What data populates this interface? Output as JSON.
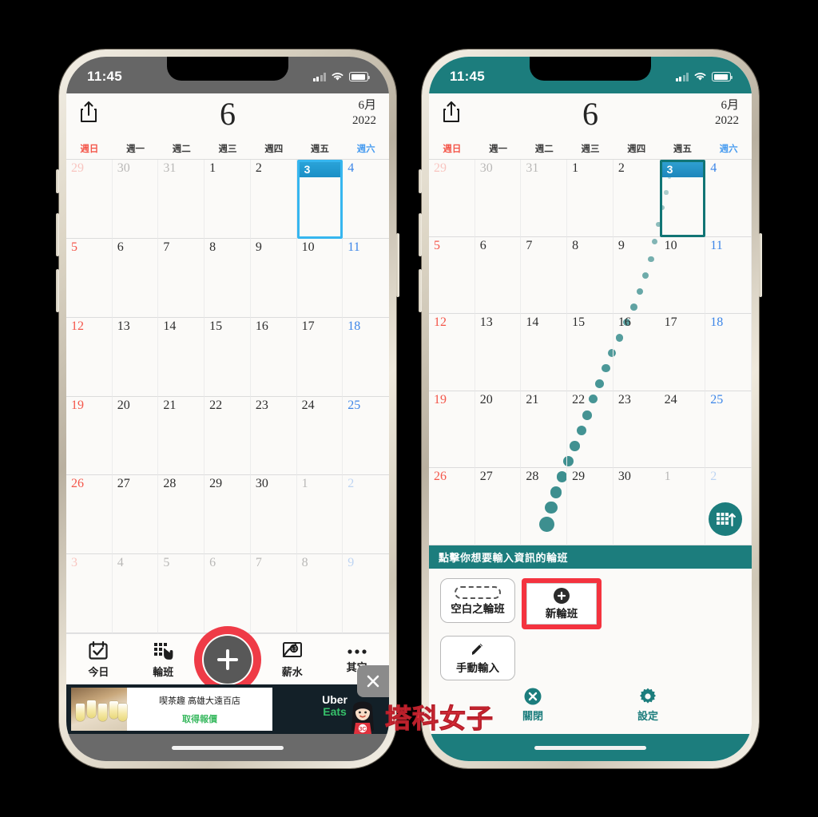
{
  "status_bar": {
    "time": "11:45",
    "signal_icon": "cellular-bars-icon",
    "wifi_icon": "wifi-icon",
    "battery_icon": "battery-icon"
  },
  "colors": {
    "teal": "#1c7d7d",
    "teal_dot": "#3d8f8f",
    "red_highlight": "#f4333f",
    "ring_red": "#ef3b47",
    "selected_blue": "#36b6ef",
    "sunday_red": "#f4564a",
    "saturday_blue": "#4a9df0",
    "status_gray": "#666666"
  },
  "header": {
    "share_icon": "share-icon",
    "month_big": "6",
    "month_label": "6月",
    "year_label": "2022"
  },
  "weekdays": [
    {
      "label": "週日",
      "kind": "sun"
    },
    {
      "label": "週一",
      "kind": "normal"
    },
    {
      "label": "週二",
      "kind": "normal"
    },
    {
      "label": "週三",
      "kind": "normal"
    },
    {
      "label": "週四",
      "kind": "normal"
    },
    {
      "label": "週五",
      "kind": "normal"
    },
    {
      "label": "週六",
      "kind": "sat"
    }
  ],
  "calendar": {
    "weeks": [
      [
        {
          "d": "29",
          "out": true,
          "kind": "sun"
        },
        {
          "d": "30",
          "out": true
        },
        {
          "d": "31",
          "out": true
        },
        {
          "d": "1"
        },
        {
          "d": "2"
        },
        {
          "d": "3",
          "selected": true
        },
        {
          "d": "4",
          "kind": "sat"
        }
      ],
      [
        {
          "d": "5",
          "kind": "sun"
        },
        {
          "d": "6"
        },
        {
          "d": "7"
        },
        {
          "d": "8"
        },
        {
          "d": "9"
        },
        {
          "d": "10"
        },
        {
          "d": "11",
          "kind": "sat"
        }
      ],
      [
        {
          "d": "12",
          "kind": "sun"
        },
        {
          "d": "13"
        },
        {
          "d": "14"
        },
        {
          "d": "15"
        },
        {
          "d": "16"
        },
        {
          "d": "17"
        },
        {
          "d": "18",
          "kind": "sat"
        }
      ],
      [
        {
          "d": "19",
          "kind": "sun"
        },
        {
          "d": "20"
        },
        {
          "d": "21"
        },
        {
          "d": "22"
        },
        {
          "d": "23"
        },
        {
          "d": "24"
        },
        {
          "d": "25",
          "kind": "sat"
        }
      ],
      [
        {
          "d": "26",
          "kind": "sun"
        },
        {
          "d": "27"
        },
        {
          "d": "28"
        },
        {
          "d": "29"
        },
        {
          "d": "30"
        },
        {
          "d": "1",
          "out": true
        },
        {
          "d": "2",
          "out": true,
          "kind": "sat"
        }
      ],
      [
        {
          "d": "3",
          "out": true,
          "kind": "sun"
        },
        {
          "d": "4",
          "out": true
        },
        {
          "d": "5",
          "out": true
        },
        {
          "d": "6",
          "out": true
        },
        {
          "d": "7",
          "out": true
        },
        {
          "d": "8",
          "out": true
        },
        {
          "d": "9",
          "out": true,
          "kind": "sat"
        }
      ]
    ]
  },
  "tabbar": {
    "items": [
      {
        "label": "今日",
        "icon": "calendar-check-icon"
      },
      {
        "label": "輪班",
        "icon": "shift-grid-hand-icon"
      },
      {
        "label": "",
        "icon": "plus-button-icon"
      },
      {
        "label": "薪水",
        "icon": "money-bag-icon"
      },
      {
        "label": "其它",
        "icon": "more-dots-icon"
      }
    ],
    "ad_close_icon": "close-icon"
  },
  "ad": {
    "title": "喫茶趣 高雄大遠百店",
    "cta": "取得報價",
    "brand_line1": "Uber",
    "brand_line2": "Eats",
    "info_icon": "info-icon",
    "close_icon": "close-icon",
    "image_alt": "drinks-photo"
  },
  "right_phone": {
    "fab_icon": "grid-upload-icon",
    "sheet_title": "點擊你想要輸入資訊的輪班",
    "options": [
      {
        "label": "空白之輪班",
        "icon": "dashed-pill-icon",
        "highlighted": false
      },
      {
        "label": "新輪班",
        "icon": "plus-circle-icon",
        "highlighted": true
      },
      {
        "label": "手動輸入",
        "icon": "pencil-icon",
        "highlighted": false
      }
    ],
    "actions": [
      {
        "label": "關閉",
        "icon": "close-circle-icon"
      },
      {
        "label": "設定",
        "icon": "gear-icon"
      }
    ]
  },
  "watermark": {
    "text": "塔科女子",
    "avatar_badge": "3C"
  }
}
